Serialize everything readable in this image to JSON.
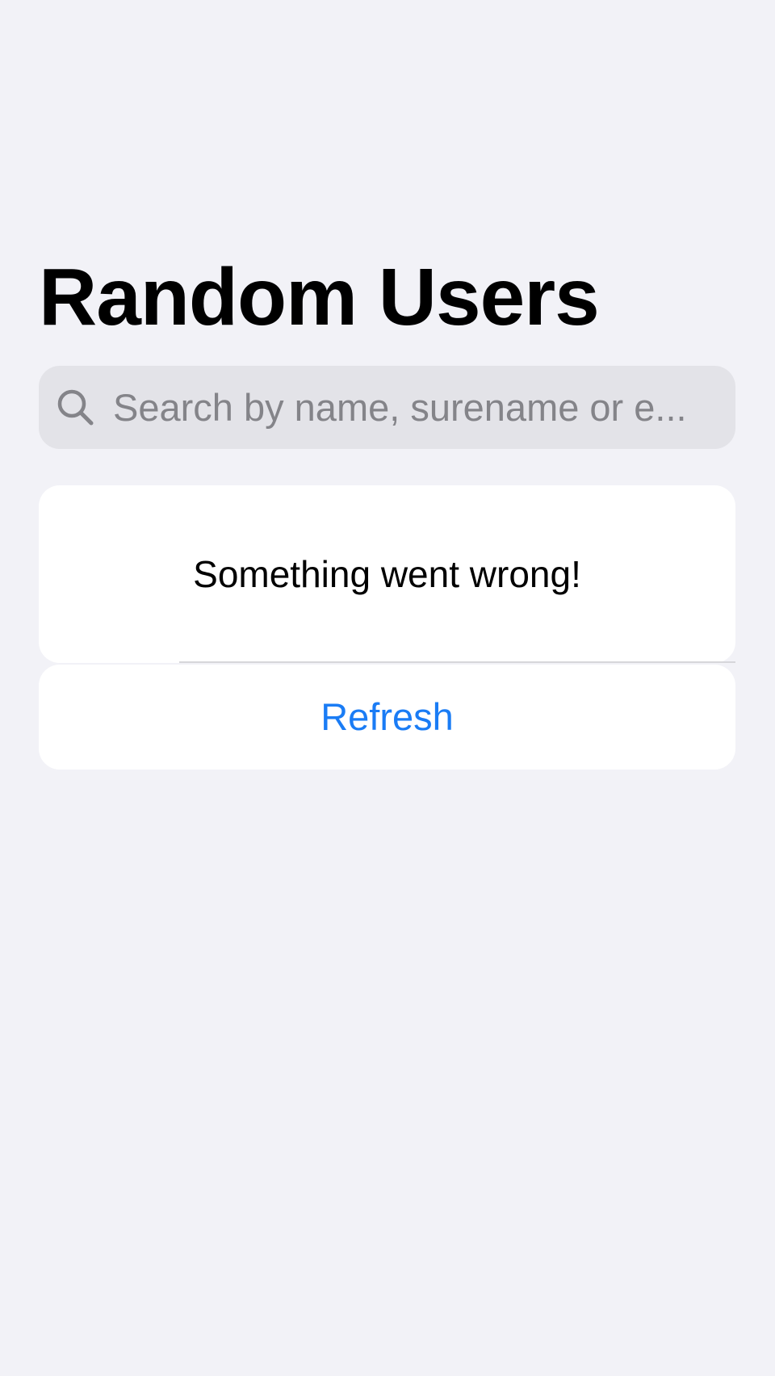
{
  "header": {
    "title": "Random Users"
  },
  "search": {
    "placeholder": "Search by name, surename or e...",
    "value": "",
    "icon": "search-icon"
  },
  "error_card": {
    "message": "Something went wrong!"
  },
  "refresh": {
    "label": "Refresh"
  },
  "colors": {
    "background": "#f2f2f7",
    "search_field": "#e3e3e8",
    "accent": "#1a7cf5",
    "placeholder": "#848489"
  }
}
